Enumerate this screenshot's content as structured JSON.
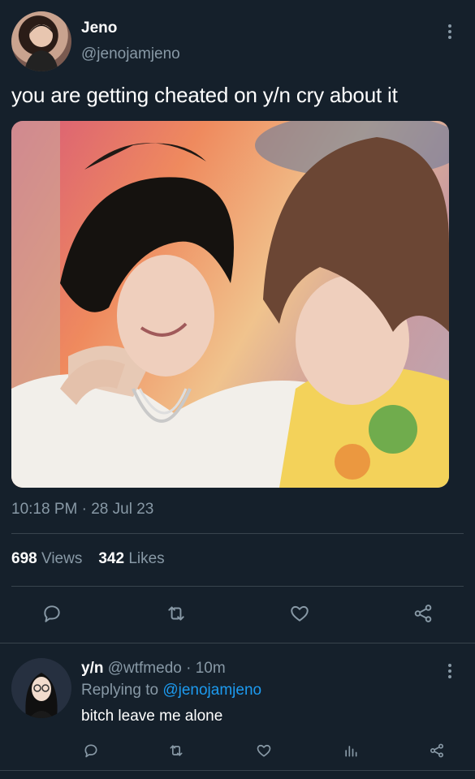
{
  "tweet": {
    "author_name": "Jeno",
    "author_handle": "@jenojamjeno",
    "text": "you are getting cheated on y/n cry about it",
    "timestamp": "10:18 PM · 28 Jul 23",
    "views_count": "698",
    "views_label": "Views",
    "likes_count": "342",
    "likes_label": "Likes",
    "actions": [
      "reply-icon",
      "retweet-icon",
      "like-icon",
      "share-icon"
    ]
  },
  "reply": {
    "author_name": "y/n",
    "author_handle": "@wtfmedo",
    "time_ago": "· 10m",
    "replying_to_prefix": "Replying to",
    "replying_to_handle": "@jenojamjeno",
    "text": "bitch leave me alone",
    "actions": [
      "reply-icon",
      "retweet-icon",
      "like-icon",
      "analytics-icon",
      "share-icon"
    ]
  },
  "colors": {
    "background": "#15202b",
    "muted": "#8899a6",
    "link": "#1d9bf0",
    "divider": "#38444d"
  }
}
